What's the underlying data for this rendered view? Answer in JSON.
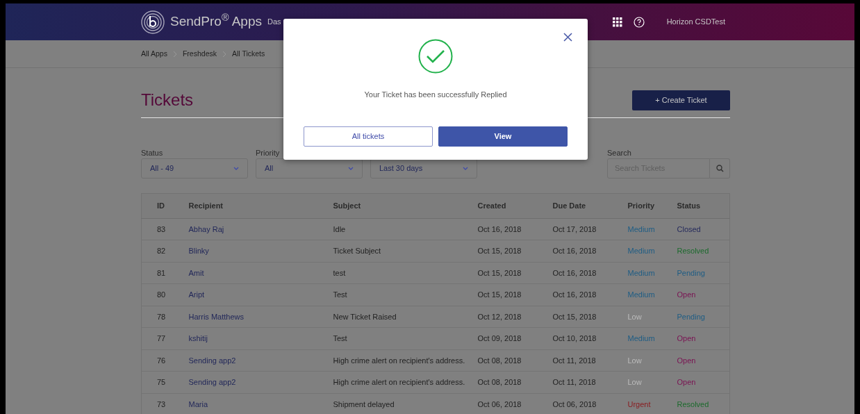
{
  "navbar": {
    "brand": "SendPro$^{®}$ Apps",
    "nav_item": "Das",
    "user": "Horizon CSDTest"
  },
  "breadcrumb": [
    "All Apps",
    "Freshdesk",
    "All Tickets"
  ],
  "page_title": "Tickets",
  "create_button": "+ Create Ticket",
  "filters": [
    {
      "label": "Status",
      "value": "All - 49"
    },
    {
      "label": "Priority",
      "value": "All"
    },
    {
      "value": "Last 30 days"
    }
  ],
  "search": {
    "label": "Search",
    "placeholder": "Search Tickets"
  },
  "table": {
    "columns": [
      "ID",
      "Recipient",
      "Subject",
      "Created",
      "Due Date",
      "Priority",
      "Status"
    ],
    "rows": [
      {
        "id": "83",
        "recipient": "Abhay Raj",
        "subject": "Idle",
        "created": "Oct 16, 2018",
        "due": "Oct 17, 2018",
        "priority": {
          "text": "Medium",
          "color": "#1d5c84"
        },
        "status": {
          "text": "Closed",
          "color": "#252a5c"
        }
      },
      {
        "id": "82",
        "recipient": "Blinky",
        "subject": "Ticket Subject",
        "created": "Oct 15, 2018",
        "due": "Oct 16, 2018",
        "priority": {
          "text": "Medium",
          "color": "#1d5c84"
        },
        "status": {
          "text": "Resolved",
          "color": "#1b6a2c"
        }
      },
      {
        "id": "81",
        "recipient": "Amit",
        "subject": "test",
        "created": "Oct 15, 2018",
        "due": "Oct 16, 2018",
        "priority": {
          "text": "Medium",
          "color": "#1d5c84"
        },
        "status": {
          "text": "Pending",
          "color": "#1d5c84"
        }
      },
      {
        "id": "80",
        "recipient": "Aript",
        "subject": "Test",
        "created": "Oct 15, 2018",
        "due": "Oct 16, 2018",
        "priority": {
          "text": "Medium",
          "color": "#1d5c84"
        },
        "status": {
          "text": "Open",
          "color": "#7a1252"
        }
      },
      {
        "id": "78",
        "recipient": "Harris Matthews",
        "subject": "New Ticket Raised",
        "created": "Oct 12, 2018",
        "due": "Oct 15, 2018",
        "priority": {
          "text": "Low",
          "color": "#bcbcbc"
        },
        "status": {
          "text": "Pending",
          "color": "#1d5c84"
        }
      },
      {
        "id": "77",
        "recipient": "kshitij",
        "subject": "Test",
        "created": "Oct 09, 2018",
        "due": "Oct 10, 2018",
        "priority": {
          "text": "Medium",
          "color": "#1d5c84"
        },
        "status": {
          "text": "Open",
          "color": "#7a1252"
        }
      },
      {
        "id": "76",
        "recipient": "Sending app2",
        "subject": "High crime alert on recipient's address.",
        "created": "Oct 08, 2018",
        "due": "Oct 11, 2018",
        "priority": {
          "text": "Low",
          "color": "#bcbcbc"
        },
        "status": {
          "text": "Open",
          "color": "#7a1252"
        }
      },
      {
        "id": "75",
        "recipient": "Sending app2",
        "subject": "High crime alert on recipient's address.",
        "created": "Oct 08, 2018",
        "due": "Oct 11, 2018",
        "priority": {
          "text": "Low",
          "color": "#bcbcbc"
        },
        "status": {
          "text": "Open",
          "color": "#7a1252"
        }
      },
      {
        "id": "73",
        "recipient": "Maria",
        "subject": "Shipment delayed",
        "created": "Oct 06, 2018",
        "due": "Oct 06, 2018",
        "priority": {
          "text": "Urgent",
          "color": "#8a1a1e"
        },
        "status": {
          "text": "Resolved",
          "color": "#1b6a2c"
        }
      }
    ]
  },
  "modal": {
    "message": "Your Ticket has been successfully Replied",
    "buttons": [
      {
        "label": "All tickets",
        "kind": "outline"
      },
      {
        "label": "View",
        "kind": "primary"
      }
    ]
  }
}
